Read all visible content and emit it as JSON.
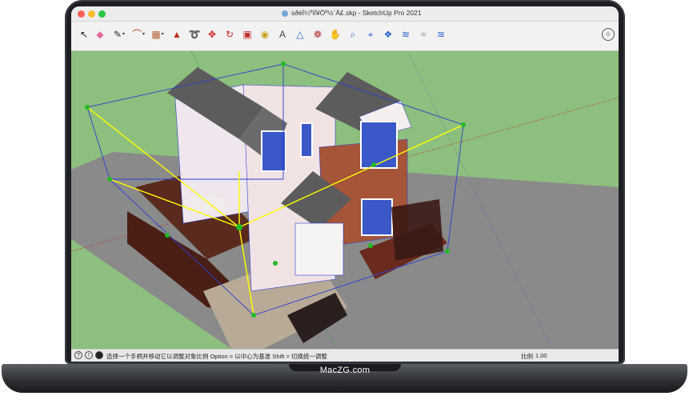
{
  "window": {
    "title": "sðèÌ¼ºìÏ¥Öº½¨Ä£.skp - SketchUp Pro 2021"
  },
  "toolbar": {
    "tools": [
      {
        "name": "select-tool-icon",
        "glyph": "↖",
        "color": "#222222"
      },
      {
        "name": "eraser-tool-icon",
        "glyph": "◆",
        "color": "#e26aa0"
      },
      {
        "name": "pencil-tool-icon",
        "glyph": "✎",
        "color": "#333333",
        "dropdown": true
      },
      {
        "name": "arc-tool-icon",
        "glyph": "⌒",
        "color": "#c04020",
        "dropdown": true
      },
      {
        "name": "rectangle-tool-icon",
        "glyph": "▦",
        "color": "#b06030",
        "dropdown": true
      },
      {
        "name": "push-pull-tool-icon",
        "glyph": "▲",
        "color": "#c03020"
      },
      {
        "name": "follow-me-tool-icon",
        "glyph": "➰",
        "color": "#c02020"
      },
      {
        "name": "move-tool-icon",
        "glyph": "✥",
        "color": "#d02020"
      },
      {
        "name": "rotate-tool-icon",
        "glyph": "↻",
        "color": "#d02020"
      },
      {
        "name": "scale-tool-icon",
        "glyph": "▣",
        "color": "#c03030"
      },
      {
        "name": "tape-measure-tool-icon",
        "glyph": "◉",
        "color": "#c8a020"
      },
      {
        "name": "text-tool-icon",
        "glyph": "A",
        "color": "#444444"
      },
      {
        "name": "paint-bucket-tool-icon",
        "glyph": "△",
        "color": "#2a64c8"
      },
      {
        "name": "orbit-tool-icon",
        "glyph": "❁",
        "color": "#b03030"
      },
      {
        "name": "pan-tool-icon",
        "glyph": "✋",
        "color": "#b07030"
      },
      {
        "name": "zoom-tool-icon",
        "glyph": "⌕",
        "color": "#2a64c8"
      },
      {
        "name": "zoom-extents-tool-icon",
        "glyph": "⌖",
        "color": "#2a64c8"
      },
      {
        "name": "extension-warehouse-icon",
        "glyph": "❖",
        "color": "#2a64c8"
      },
      {
        "name": "3d-warehouse-icon",
        "glyph": "≋",
        "color": "#2a64c8"
      },
      {
        "name": "sandbox-tool-icon",
        "glyph": "≈",
        "color": "#7a8ca8"
      },
      {
        "name": "layout-icon",
        "glyph": "≊",
        "color": "#2a64c8"
      }
    ]
  },
  "statusbar": {
    "message": "选择一个手柄并移动它以调整对象比例  Option = 以中心为基准  Shift = 切换统一调整",
    "scale_label": "比例",
    "scale_value": "1.00",
    "info_icon": "?",
    "credit_icon": "!"
  },
  "brand": "MacZG.com",
  "colors": {
    "sky": "#8dbf7e",
    "ground": "#888888",
    "selection": "#ffff00",
    "handle": "#22bb22",
    "bounding": "#2a40d0"
  }
}
